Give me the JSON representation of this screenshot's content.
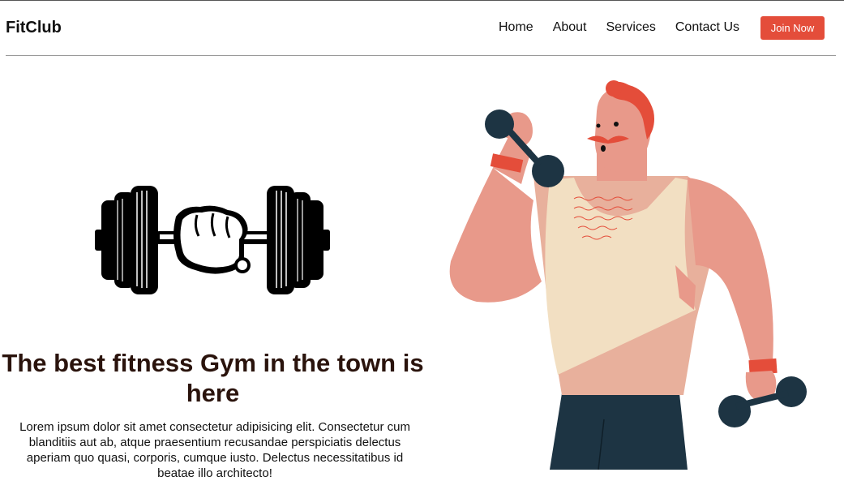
{
  "navbar": {
    "brand": "FitClub",
    "links": [
      "Home",
      "About",
      "Services",
      "Contact Us"
    ],
    "cta_label": "Join Now"
  },
  "hero": {
    "title": "The best fitness Gym in the town is here",
    "description": "Lorem ipsum dolor sit amet consectetur adipisicing elit. Consectetur cum blanditiis aut ab, atque praesentium recusandae perspiciatis delectus aperiam quo quasi, corporis, cumque iusto. Delectus necessitatibus id beatae illo architecto!"
  },
  "colors": {
    "accent": "#e44d3a",
    "title": "#2a130c",
    "skin": "#e8998a",
    "tank_top": "#f2dfc2",
    "pants": "#1d3443"
  },
  "icons": {
    "logo": "fist-dumbbell-icon",
    "illustration": "man-lifting-dumbbells"
  }
}
